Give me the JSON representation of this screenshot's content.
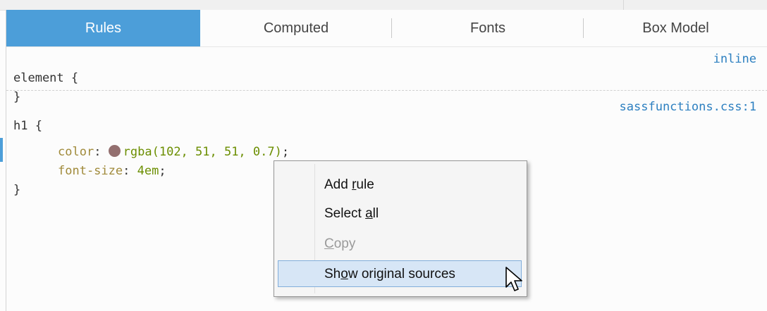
{
  "tabs": [
    {
      "label": "Rules",
      "active": true
    },
    {
      "label": "Computed",
      "active": false
    },
    {
      "label": "Fonts",
      "active": false
    },
    {
      "label": "Box Model",
      "active": false
    }
  ],
  "rules": {
    "element": {
      "selector": "element",
      "open": " {",
      "close": "}",
      "source": "inline"
    },
    "h1": {
      "selector": "h1",
      "open": " {",
      "close": "}",
      "source": "sassfunctions.css:1",
      "declarations": [
        {
          "property": "color",
          "value": "rgba(102, 51, 51, 0.7)",
          "swatch_color": "#664433"
        },
        {
          "property": "font-size",
          "value": "4em"
        }
      ]
    }
  },
  "context_menu": {
    "items": [
      {
        "pre": "Add ",
        "mnemonic": "r",
        "post": "ule",
        "state": "normal"
      },
      {
        "pre": "Select ",
        "mnemonic": "a",
        "post": "ll",
        "state": "normal"
      },
      {
        "pre": "",
        "mnemonic": "C",
        "post": "opy",
        "state": "disabled"
      },
      {
        "pre": "Sh",
        "mnemonic": "o",
        "post": "w original sources",
        "state": "hover"
      }
    ]
  },
  "colors": {
    "accent": "#4c9ed9",
    "link": "#2c7fc0",
    "property": "#a08a3a",
    "value": "#6b8e00",
    "menu_hover": "#d7e6f6"
  },
  "icons": [
    "color-swatch-icon",
    "mouse-pointer-icon"
  ]
}
